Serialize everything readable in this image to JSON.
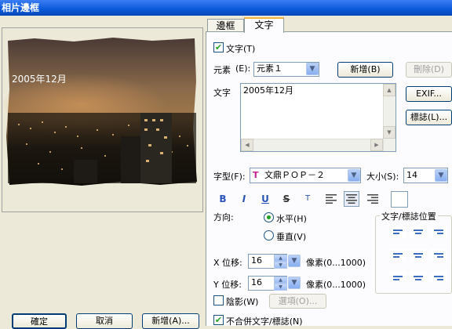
{
  "window": {
    "title": "相片邊框"
  },
  "tabs": [
    {
      "label": "邊框"
    },
    {
      "label": "文字"
    }
  ],
  "preview": {
    "photo_text": "2005年12月"
  },
  "text_tab": {
    "enable_label": "文字(T)",
    "element_label": "元素",
    "element_key": "(E):",
    "element_value": "元素１",
    "add_button": "新增(B)",
    "delete_button": "刪除(D)",
    "text_label": "文字",
    "text_value": "2005年12月",
    "exif_button": "EXIF...",
    "logo_button": "標誌(L)...",
    "font_label": "字型(F):",
    "font_value": "文鼎ＰＯＰ－２",
    "size_label": "大小(S):",
    "size_value": "14",
    "direction_label": "方向:",
    "horizontal_label": "水平(H)",
    "vertical_label": "垂直(V)",
    "position_group_label": "文字/標誌位置",
    "x_offset_label": "X 位移:",
    "x_offset_value": "16",
    "x_unit": "像素(0...1000)",
    "y_offset_label": "Y 位移:",
    "y_offset_value": "16",
    "y_unit": "像素(0...1000)",
    "shadow_label": "陰影(W)",
    "options_button": "選項(O)...",
    "merge_label": "不合併文字/標誌(N)"
  },
  "format_buttons": [
    "B",
    "I",
    "U",
    "S",
    "T"
  ],
  "footer": {
    "ok_button": "確定",
    "cancel_button": "取消",
    "add_button": "新增(A)..."
  },
  "colors": {
    "accent": "#21a121",
    "titlebar": "#0a58d8"
  }
}
